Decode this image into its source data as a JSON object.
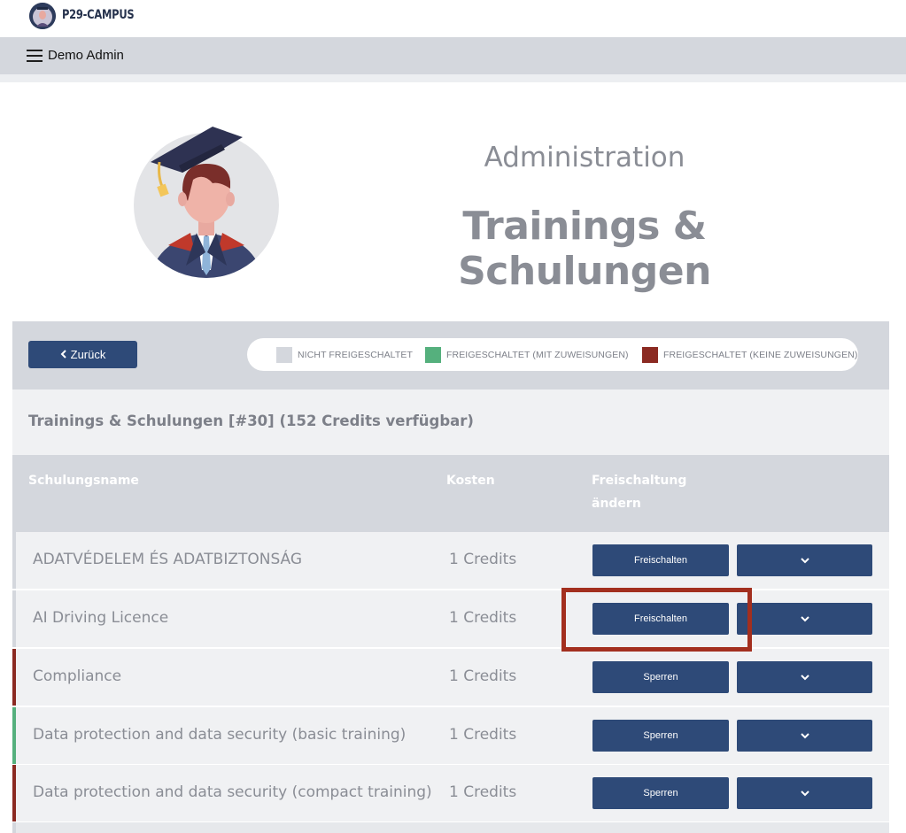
{
  "app": {
    "logo_text": "P29-CAMPUS"
  },
  "navbar": {
    "user_label": "Demo Admin"
  },
  "hero": {
    "subtitle": "Administration",
    "title": "Trainings & Schulungen"
  },
  "toolbar": {
    "back_label": "Zurück"
  },
  "legend": [
    {
      "label": "NICHT FREIGESCHALTET",
      "color": "#d4d7dd"
    },
    {
      "label": "FREIGESCHALTET (MIT ZUWEISUNGEN)",
      "color": "#55b07d"
    },
    {
      "label": "FREIGESCHALTET (KEINE ZUWEISUNGEN)",
      "color": "#8b2a22"
    }
  ],
  "section": {
    "title": "Trainings & Schulungen [#30] (152 Credits verfügbar)"
  },
  "table": {
    "headers": {
      "name": "Schulungsname",
      "cost": "Kosten",
      "action_line1": "Freischaltung",
      "action_line2": "ändern"
    },
    "rows": [
      {
        "name": "ADATVÉDELEM ÉS ADATBIZTONSÁG",
        "cost": "1 Credits",
        "action": "Freischalten",
        "status_color": "#d4d7dd"
      },
      {
        "name": "AI Driving Licence",
        "cost": "1 Credits",
        "action": "Freischalten",
        "status_color": "#d4d7dd"
      },
      {
        "name": "Compliance",
        "cost": "1 Credits",
        "action": "Sperren",
        "status_color": "#8b2a22"
      },
      {
        "name": "Data protection and data security (basic training)",
        "cost": "1 Credits",
        "action": "Sperren",
        "status_color": "#55b07d"
      },
      {
        "name": "Data protection and data security (compact training)",
        "cost": "1 Credits",
        "action": "Sperren",
        "status_color": "#8b2a22"
      }
    ]
  },
  "colors": {
    "primary": "#2e4a78",
    "highlight": "#a32f1f"
  },
  "icons": {
    "menu": "hamburger-icon",
    "back": "chevron-left-icon",
    "dropdown": "chevron-down-icon"
  }
}
